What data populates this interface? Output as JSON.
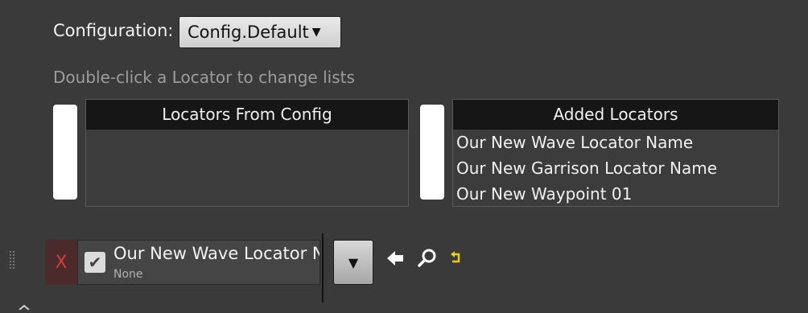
{
  "config": {
    "label": "Configuration:",
    "selected": "Config.Default"
  },
  "hint": "Double-click a Locator to change lists",
  "lists": {
    "from_config": {
      "header": "Locators From Config",
      "items": []
    },
    "added": {
      "header": "Added Locators",
      "items": [
        "Our New Wave Locator Name",
        "Our New Garrison Locator Name",
        "Our New Waypoint 01"
      ]
    }
  },
  "entry": {
    "remove_glyph": "X",
    "title": "Our New Wave Locator N",
    "subtitle": "None",
    "checked": true
  },
  "icons": {
    "dropdown_caret": "caret-down-icon",
    "checkbox": "checkmark-icon",
    "combo": "caret-down-icon",
    "use_selected": "arrow-left-icon",
    "browse": "magnifier-icon",
    "reset": "reset-arrow-icon",
    "grip": "drag-grip-icon"
  },
  "colors": {
    "background": "#3a3a3a",
    "header": "#161616",
    "remove": "#d63a3a",
    "reset_icon": "#e8d20a",
    "hint": "#9c9c9c"
  }
}
